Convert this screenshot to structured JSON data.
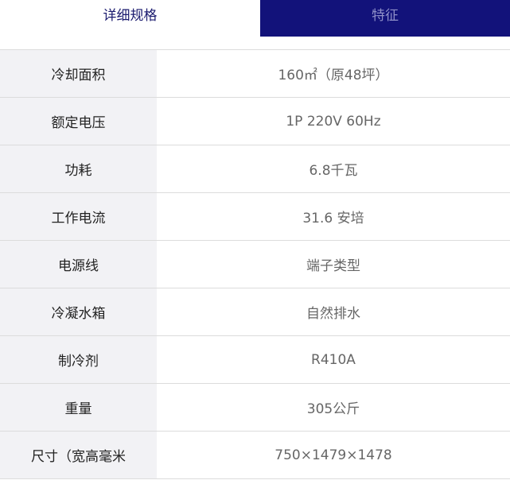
{
  "tabs": {
    "details_label": "详细规格",
    "features_label": "特征"
  },
  "colors": {
    "tab_active_text": "#1a1a6e",
    "tab_inactive_bg": "#12127a",
    "tab_inactive_text": "#8f90c8",
    "label_bg": "#f2f2f5",
    "border": "#dcdcdc"
  },
  "specs": [
    {
      "label": "冷却面积",
      "value": "160㎡（原48坪）"
    },
    {
      "label": "额定电压",
      "value": "1P 220V 60Hz"
    },
    {
      "label": "功耗",
      "value": "6.8千瓦"
    },
    {
      "label": "工作电流",
      "value": "31.6 安培"
    },
    {
      "label": "电源线",
      "value": "端子类型"
    },
    {
      "label": "冷凝水箱",
      "value": "自然排水"
    },
    {
      "label": "制冷剂",
      "value": "R410A"
    },
    {
      "label": "重量",
      "value": "305公斤"
    },
    {
      "label": "尺寸（宽高毫米",
      "value": "750×1479×1478"
    }
  ]
}
